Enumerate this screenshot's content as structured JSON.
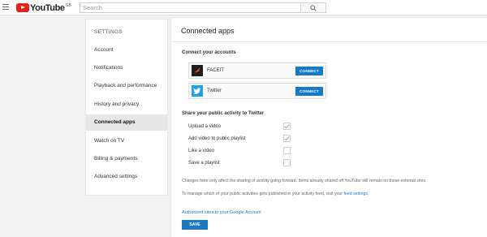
{
  "header": {
    "logo_text": "YouTube",
    "logo_country": "GB",
    "search": {
      "placeholder": "Search",
      "value": ""
    }
  },
  "sidebar": {
    "heading": "SETTINGS",
    "items": [
      {
        "label": "Account"
      },
      {
        "label": "Notifications"
      },
      {
        "label": "Playback and performance"
      },
      {
        "label": "History and privacy"
      },
      {
        "label": "Connected apps",
        "active": true
      },
      {
        "label": "Watch on TV"
      },
      {
        "label": "Billing & payments"
      },
      {
        "label": "Advanced settings"
      }
    ]
  },
  "main": {
    "title": "Connected apps",
    "connect_heading": "Connect your accounts",
    "accounts": [
      {
        "name": "FACEIT",
        "button": "CONNECT",
        "icon": "faceit-icon"
      },
      {
        "name": "Twitter",
        "button": "CONNECT",
        "icon": "twitter-icon"
      }
    ],
    "share_heading": "Share your public activity to Twitter",
    "share_options": [
      {
        "label": "Upload a video",
        "checked": true
      },
      {
        "label": "Add video to public playlist",
        "checked": true
      },
      {
        "label": "Like a video",
        "checked": false
      },
      {
        "label": "Save a playlist",
        "checked": false
      }
    ],
    "note_1": "Changes here only affect the sharing of activity going forward. Items already shared off YouTube will remain on those external sites.",
    "note_2_prefix": "To manage which of your public activities gets published in your activity feed, visit your ",
    "note_2_link": "feed settings",
    "note_2_suffix": ".",
    "authorized_link": "Authorized sites to your Google Account",
    "save_label": "SAVE"
  },
  "colors": {
    "accent": "#167ac6",
    "brand_red": "#e62117",
    "twitter_blue": "#1da1f2"
  }
}
